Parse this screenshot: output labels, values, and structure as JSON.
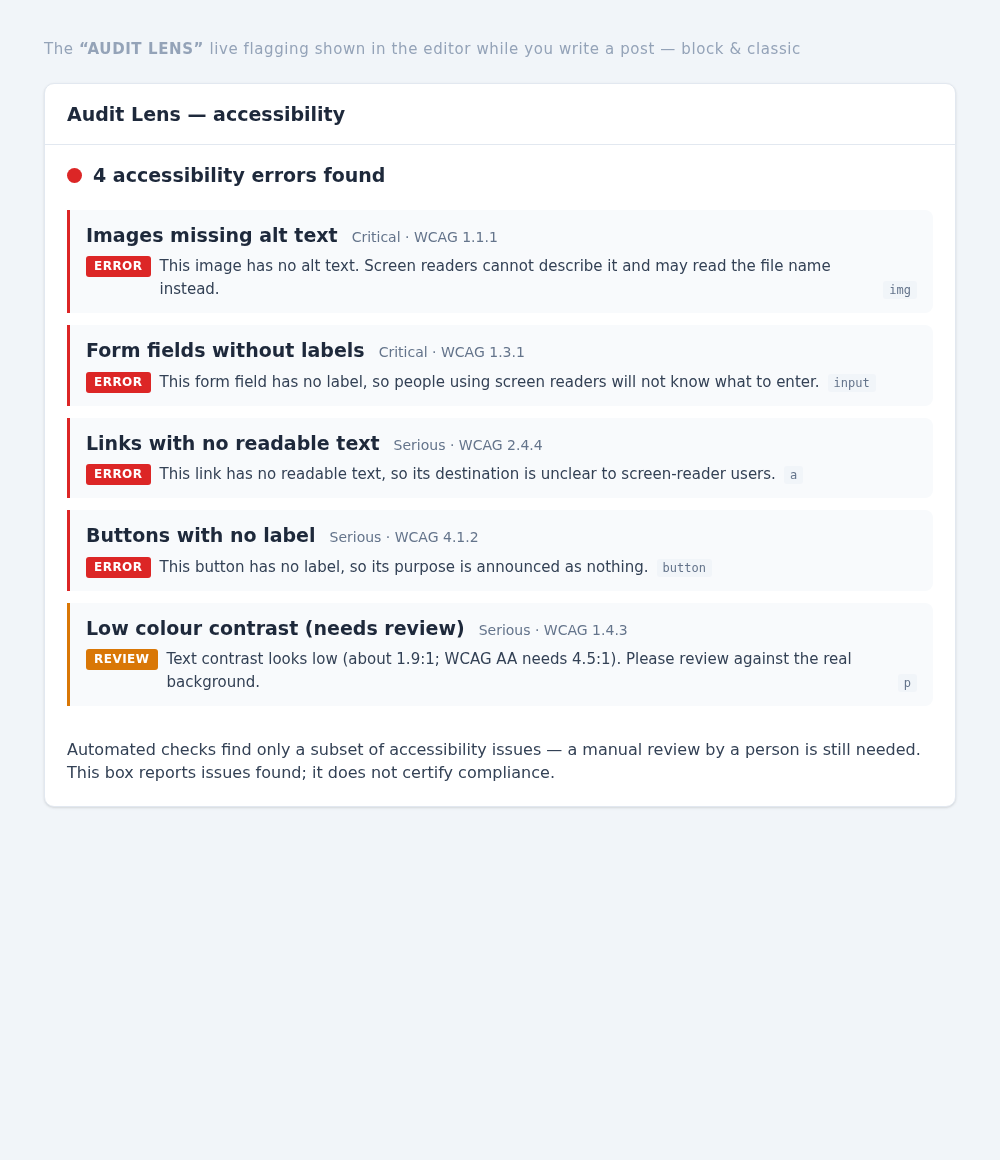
{
  "caption": "The **“AUDIT LENS”** live flagging shown in the editor while you write a post — block & classic",
  "panel": {
    "title": "Audit Lens — accessibility"
  },
  "summary": "4 accessibility errors found",
  "issues": [
    {
      "kind": "error",
      "title": "Images missing alt text",
      "meta": "Critical · WCAG 1.1.1",
      "badge": "ERROR",
      "description": "This image has no alt text. Screen readers cannot describe it and may read the file name instead.",
      "tag": "img"
    },
    {
      "kind": "error",
      "title": "Form fields without labels",
      "meta": "Critical · WCAG 1.3.1",
      "badge": "ERROR",
      "description": "This form field has no label, so people using screen readers will not know what to enter.",
      "tag": "input"
    },
    {
      "kind": "error",
      "title": "Links with no readable text",
      "meta": "Serious · WCAG 2.4.4",
      "badge": "ERROR",
      "description": "This link has no readable text, so its destination is unclear to screen-reader users.",
      "tag": "a"
    },
    {
      "kind": "error",
      "title": "Buttons with no label",
      "meta": "Serious · WCAG 4.1.2",
      "badge": "ERROR",
      "description": "This button has no label, so its purpose is announced as nothing.",
      "tag": "button"
    },
    {
      "kind": "review",
      "title": "Low colour contrast (needs review)",
      "meta": "Serious · WCAG 1.4.3",
      "badge": "REVIEW",
      "description": "Text contrast looks low (about 1.9:1; WCAG AA needs 4.5:1). Please review against the real background.",
      "tag": "p"
    }
  ],
  "footnote": "Automated checks find only a subset of accessibility issues — a manual review by a person is still needed. This box reports issues found; it does not certify compliance."
}
